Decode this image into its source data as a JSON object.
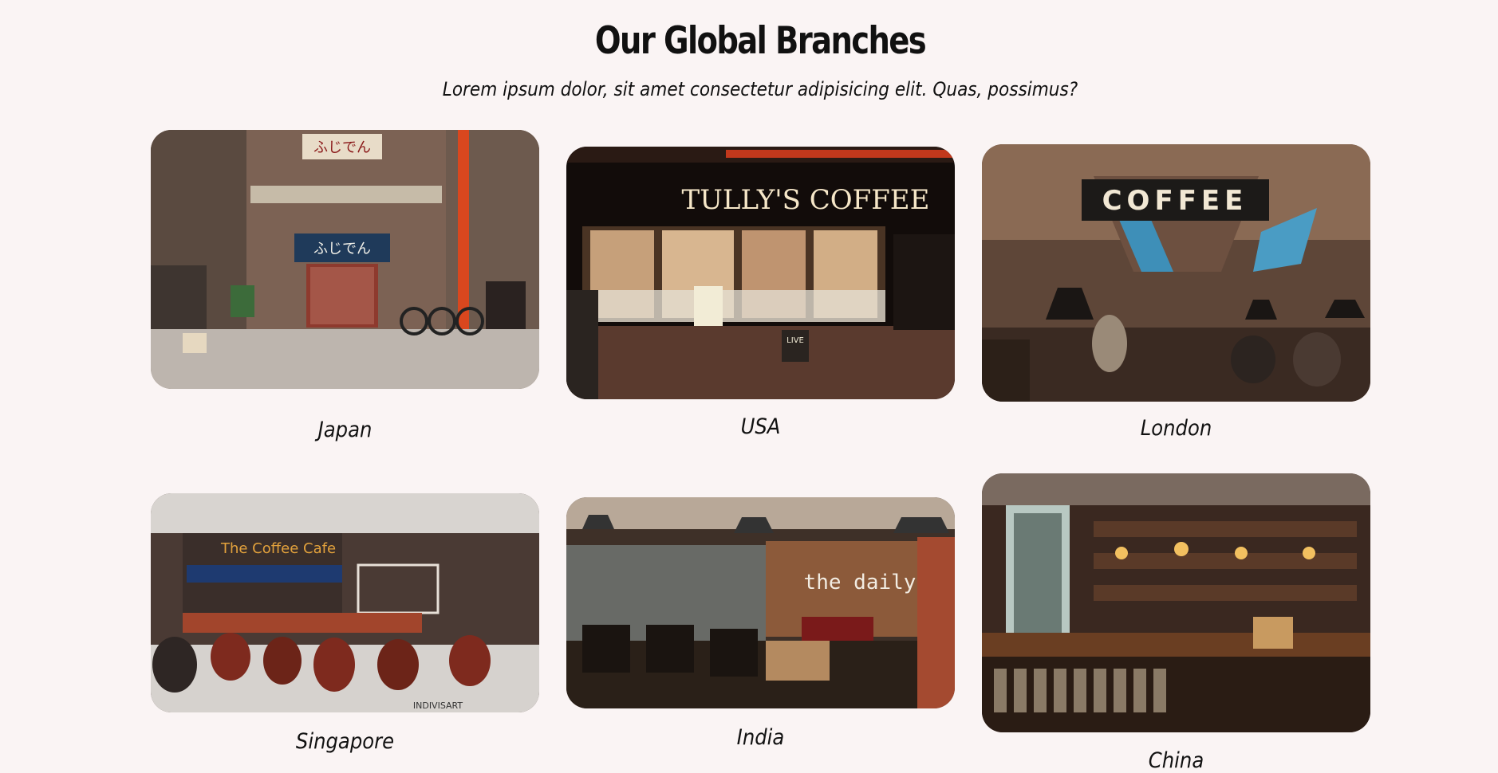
{
  "section": {
    "title": "Our Global Branches",
    "subtitle": "Lorem ipsum dolor, sit amet consectetur adipisicing elit. Quas, possimus?"
  },
  "branches": [
    {
      "label": "Japan",
      "image": {
        "sign": "ふじでん",
        "noren": "ふじでん"
      }
    },
    {
      "label": "USA",
      "image": {
        "sign": "TULLY'S COFFEE",
        "board": "LIVE"
      }
    },
    {
      "label": "London",
      "image": {
        "sign": "COFFEE"
      }
    },
    {
      "label": "Singapore",
      "image": {
        "sign": "The Coffee Cafe",
        "credit": "INDIVISART"
      }
    },
    {
      "label": "India",
      "image": {
        "sign": "the daily"
      }
    },
    {
      "label": "China",
      "image": {}
    }
  ],
  "icons": {
    "japan": "storefront-photo",
    "usa": "night-cafe-photo",
    "london": "cafe-interior-photo",
    "singapore": "cafe-render-photo",
    "india": "restaurant-interior-photo",
    "china": "bar-counter-photo"
  }
}
